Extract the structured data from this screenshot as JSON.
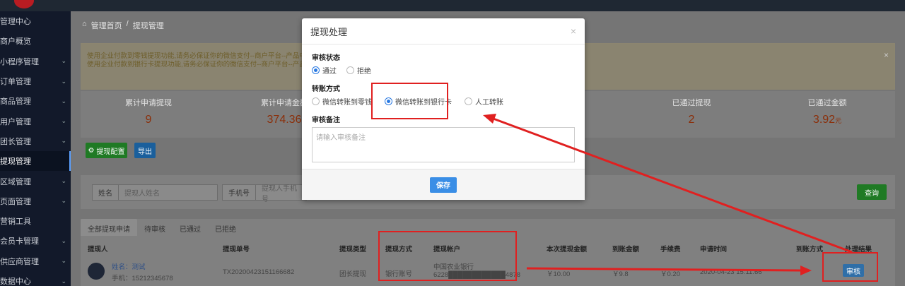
{
  "sidebar": {
    "items": [
      {
        "label": "管理中心",
        "chevron": false
      },
      {
        "label": "商户概览",
        "chevron": false
      },
      {
        "label": "小程序管理",
        "chevron": true
      },
      {
        "label": "订单管理",
        "chevron": true
      },
      {
        "label": "商品管理",
        "chevron": true
      },
      {
        "label": "用户管理",
        "chevron": true
      },
      {
        "label": "团长管理",
        "chevron": true
      },
      {
        "label": "提现管理",
        "chevron": false,
        "active": true
      },
      {
        "label": "区域管理",
        "chevron": true
      },
      {
        "label": "页面管理",
        "chevron": true
      },
      {
        "label": "营销工具",
        "chevron": false
      },
      {
        "label": "会员卡管理",
        "chevron": true
      },
      {
        "label": "供应商管理",
        "chevron": true
      },
      {
        "label": "数据中心",
        "chevron": true
      }
    ],
    "chevron_glyph": "⌄"
  },
  "breadcrumb": {
    "home": "管理首页",
    "sep": "/",
    "current": "提现管理"
  },
  "notice": {
    "line1": "使用企业付款到零钱提现功能,请务必保证你的微信支付--商户平台--产品中心--企业",
    "line2": "使用企业付款到银行卡提现功能,请务必保证你的微信支付--商户平台--产品中心--企",
    "close": "×"
  },
  "stats": [
    {
      "label": "累计申请提现",
      "value": "9",
      "unit": ""
    },
    {
      "label": "累计申请金额",
      "value": "374.36",
      "unit": ""
    },
    {
      "label": "",
      "value": "",
      "unit": ""
    },
    {
      "label": "",
      "value": "",
      "unit": ""
    },
    {
      "label": "已通过提现",
      "value": "2",
      "unit": ""
    },
    {
      "label": "已通过金额",
      "value": "3.92",
      "unit": "元"
    }
  ],
  "actions": {
    "config": "提现配置",
    "export": "导出",
    "gear": "⚙"
  },
  "search": {
    "name_label": "姓名",
    "name_placeholder": "提现人姓名",
    "phone_label": "手机号",
    "phone_placeholder": "提现人手机号",
    "query": "查询"
  },
  "tabs": [
    "全部提现申请",
    "待审核",
    "已通过",
    "已拒绝"
  ],
  "table": {
    "headers": [
      "提现人",
      "提现单号",
      "提现类型",
      "提现方式",
      "提现帐户",
      "本次提现金额",
      "到账金额",
      "手续费",
      "申请时间",
      "到账方式",
      "处理结果"
    ],
    "row": {
      "name": "姓名：测试",
      "phone": "手机：15212345678",
      "order": "TX20200423151166682",
      "type": "团长提现",
      "method": "银行账号",
      "bank": "中国农业银行",
      "account": "6228████████████4878",
      "amount": "￥10.00",
      "received": "￥9.8",
      "fee": "￥0.20",
      "time": "2020-04-23 15:11:66",
      "received_way": "",
      "action": "审核"
    }
  },
  "modal": {
    "title": "提现处理",
    "close": "×",
    "status_label": "审核状态",
    "status_options": [
      {
        "label": "通过",
        "checked": true
      },
      {
        "label": "拒绝",
        "checked": false
      }
    ],
    "transfer_label": "转账方式",
    "transfer_options": [
      {
        "label": "微信转账到零钱",
        "checked": false
      },
      {
        "label": "微信转账到银行卡",
        "checked": true
      },
      {
        "label": "人工转账",
        "checked": false
      }
    ],
    "remark_label": "审核备注",
    "remark_placeholder": "请输入审核备注",
    "save": "保存"
  },
  "colors": {
    "highlight": "#e02020",
    "primary": "#3a8ee6",
    "sidebar": "#12192a"
  }
}
